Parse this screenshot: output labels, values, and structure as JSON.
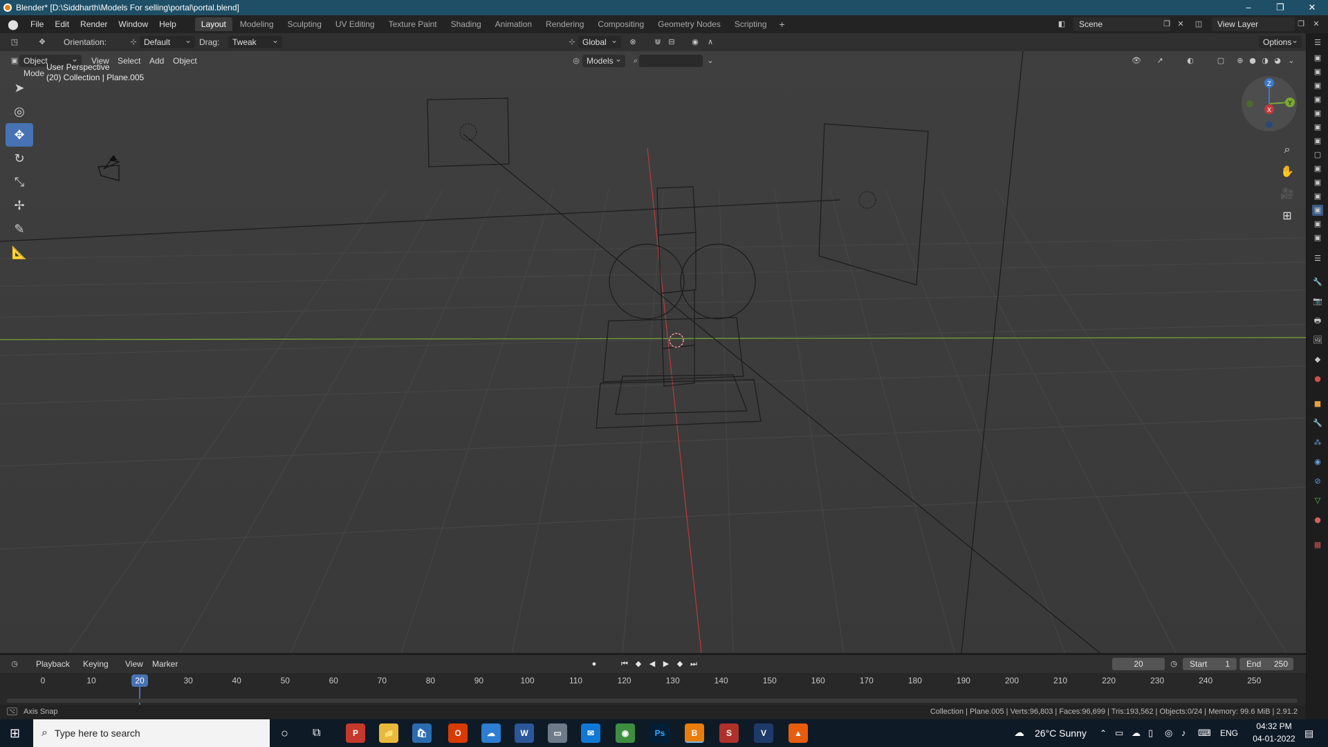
{
  "window": {
    "title": "Blender* [D:\\Siddharth\\Models For selling\\portal\\portal.blend]",
    "controls": [
      "–",
      "❐",
      "✕"
    ]
  },
  "menubar": {
    "menus": [
      "File",
      "Edit",
      "Render",
      "Window",
      "Help"
    ],
    "workspaces": [
      "Layout",
      "Modeling",
      "Sculpting",
      "UV Editing",
      "Texture Paint",
      "Shading",
      "Animation",
      "Rendering",
      "Compositing",
      "Geometry Nodes",
      "Scripting"
    ],
    "active_workspace": "Layout",
    "add_symbol": "+",
    "scene": "Scene",
    "view_layer": "View Layer"
  },
  "tool_header": {
    "orientation_label": "Orientation:",
    "orientation_value": "Default",
    "drag_label": "Drag:",
    "drag_value": "Tweak",
    "transform_orientation": "Global",
    "options": "Options"
  },
  "viewport_header": {
    "mode": "Object Mode",
    "menus": [
      "View",
      "Select",
      "Add",
      "Object"
    ],
    "models_dropdown": "Models"
  },
  "viewport": {
    "perspective_label": "User Perspective",
    "collection_label": "(20) Collection | Plane.005",
    "gizmo_axes": [
      "X",
      "Y",
      "Z"
    ],
    "colors": {
      "background": "#3d3d3d",
      "x_axis": "#c0393b",
      "y_axis": "#7aa832",
      "selection": "#4772b3"
    }
  },
  "tools": [
    "tweak-select",
    "cursor",
    "move",
    "rotate",
    "scale",
    "transform",
    "annotate",
    "measure"
  ],
  "timeline": {
    "menus": [
      "Playback",
      "Keying",
      "View",
      "Marker"
    ],
    "current_frame": "20",
    "start_label": "Start",
    "start_value": "1",
    "end_label": "End",
    "end_value": "250",
    "ticks": [
      "0",
      "10",
      "20",
      "30",
      "40",
      "50",
      "60",
      "70",
      "80",
      "90",
      "100",
      "110",
      "120",
      "130",
      "140",
      "150",
      "160",
      "170",
      "180",
      "190",
      "200",
      "210",
      "220",
      "230",
      "240",
      "250"
    ]
  },
  "statusbar": {
    "left": "Axis Snap",
    "right": "Collection | Plane.005 | Verts:96,803 | Faces:96,699 | Tris:193,562 | Objects:0/24 | Memory: 99.6 MiB | 2.91.2"
  },
  "taskbar": {
    "search_placeholder": "Type here to search",
    "weather": "26°C  Sunny",
    "language": "ENG",
    "time": "04:32 PM",
    "date": "04-01-2022",
    "apps": [
      "P",
      "📁",
      "🛍",
      "O",
      "☁",
      "W",
      "▭",
      "✉",
      "◉",
      "Ps",
      "B",
      "S",
      "V",
      "▲"
    ]
  }
}
